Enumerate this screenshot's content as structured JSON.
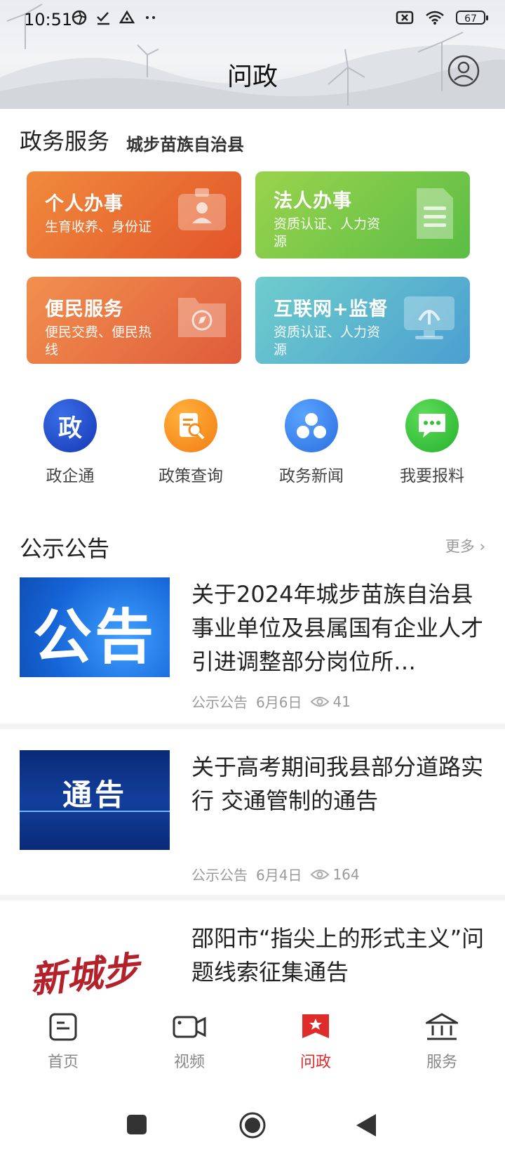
{
  "status_bar": {
    "time": "10:51",
    "battery": "67"
  },
  "header": {
    "title": "问政"
  },
  "gov_service": {
    "title": "政务服务",
    "region": "城步苗族自治县",
    "cards": [
      {
        "title": "个人办事",
        "desc": "生育收养、身份证"
      },
      {
        "title": "法人办事",
        "desc": "资质认证、人力资源"
      },
      {
        "title": "便民服务",
        "desc": "便民交费、便民热线"
      },
      {
        "title": "互联网+监督",
        "desc": "资质认证、人力资源"
      }
    ]
  },
  "quick_links": [
    {
      "label": "政企通",
      "glyph": "政",
      "color": "#1a47c4"
    },
    {
      "label": "政策查询",
      "color": "#f58a18"
    },
    {
      "label": "政务新闻",
      "color": "#2f7fe8"
    },
    {
      "label": "我要报料",
      "color": "#35c237"
    }
  ],
  "notices": {
    "title": "公示公告",
    "more": "更多",
    "items": [
      {
        "thumb_text": "公告",
        "title": "关于2024年城步苗族自治县事业单位及县属国有企业人才引进调整部分岗位所…",
        "category": "公示公告",
        "date": "6月6日",
        "views": "41"
      },
      {
        "thumb_text": "通告",
        "title": "关于高考期间我县部分道路实行 交通管制的通告",
        "category": "公示公告",
        "date": "6月4日",
        "views": "164"
      },
      {
        "thumb_text": "新城步",
        "title": "邵阳市“指尖上的形式主义”问题线索征集通告"
      }
    ]
  },
  "tabbar": [
    {
      "label": "首页",
      "icon": "home-icon"
    },
    {
      "label": "视频",
      "icon": "video-icon"
    },
    {
      "label": "问政",
      "icon": "wenzheng-icon",
      "active": true
    },
    {
      "label": "服务",
      "icon": "service-icon"
    }
  ],
  "colors": {
    "accent": "#e02b2b"
  }
}
